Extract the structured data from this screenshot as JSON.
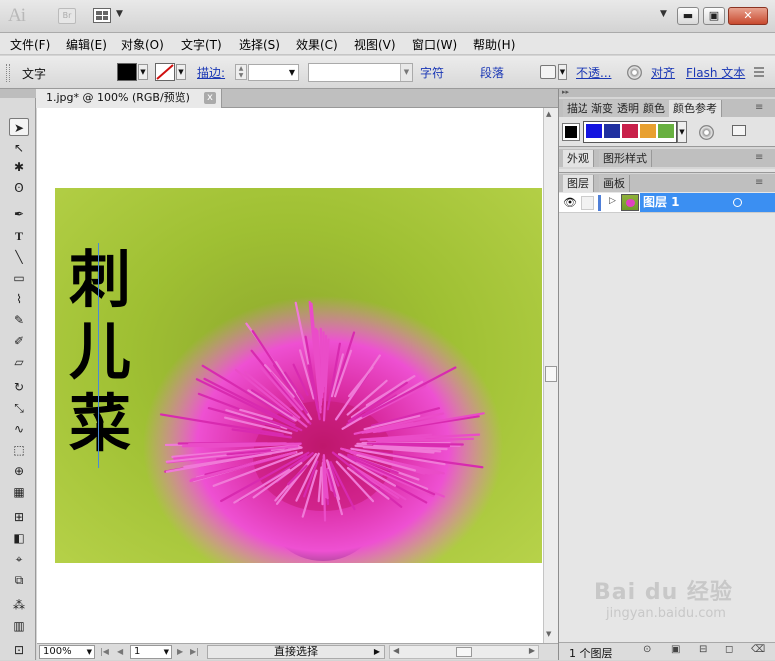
{
  "titlebar": {
    "app_logo": "Ai",
    "bridge_label": "Br",
    "window_min": "▬",
    "window_max": "▣",
    "window_close": "✕"
  },
  "menu": [
    "文件(F)",
    "编辑(E)",
    "对象(O)",
    "文字(T)",
    "选择(S)",
    "效果(C)",
    "视图(V)",
    "窗口(W)",
    "帮助(H)"
  ],
  "control": {
    "mode_label": "文字",
    "stroke_label": "描边:",
    "char_label": "字符",
    "para_label": "段落",
    "opacity_label": "不透...",
    "align_label": "对齐",
    "flash_label": "Flash 文本"
  },
  "document": {
    "tab_title": "1.jpg* @ 100% (RGB/预览)",
    "tab_close": "x"
  },
  "artwork": {
    "vertical_text": [
      "刺",
      "儿",
      "菜"
    ]
  },
  "status": {
    "zoom": "100%",
    "page": "1",
    "tool_name": "直接选择"
  },
  "panels": {
    "top_tabs": [
      "描边",
      "渐变",
      "透明",
      "颜色",
      "颜色参考"
    ],
    "mid_tabs": [
      "外观",
      "图形样式"
    ],
    "layer_tabs": [
      "图层",
      "画板"
    ],
    "layer_name": "图层 1",
    "layer_count": "1 个图层",
    "guide_colors": [
      "#1414e0",
      "#2030a0",
      "#c8204a",
      "#e8a030",
      "#68b040"
    ]
  },
  "watermark": {
    "brand": "Bai du 经验",
    "url": "jingyan.baidu.com"
  }
}
